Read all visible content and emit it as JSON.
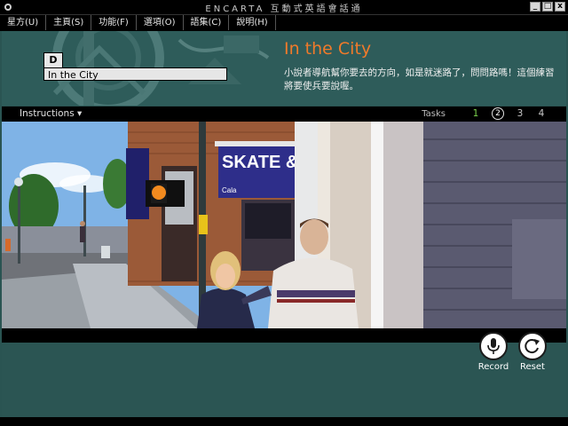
{
  "window": {
    "title": "ENCARTA 互動式英語會話通",
    "buttons": {
      "minimize": "_",
      "maximize": "□",
      "close": "x"
    }
  },
  "menu": {
    "items": [
      "星方(U)",
      "主頁(S)",
      "功能(F)",
      "選項(O)",
      "語集(C)",
      "說明(H)"
    ]
  },
  "lesson": {
    "badge": "D",
    "name": "In the City"
  },
  "header": {
    "title": "In the City",
    "description": "小說者導航幫你要去的方向，如是就迷路了，問問路嗎！這個練習將要使兵要說喔。"
  },
  "toolbar": {
    "instructions_label": "Instructions",
    "tasks_label": "Tasks",
    "tasks": [
      "1",
      "2",
      "3",
      "4"
    ],
    "current_task": "2"
  },
  "scene": {
    "store_sign": "SKATE &",
    "store_sign_small": "Cala"
  },
  "controls": {
    "record_label": "Record",
    "reset_label": "Reset"
  },
  "colors": {
    "accent_title": "#f07a2a",
    "panel": "#2e5c5a",
    "task_first": "#7cd34d"
  }
}
